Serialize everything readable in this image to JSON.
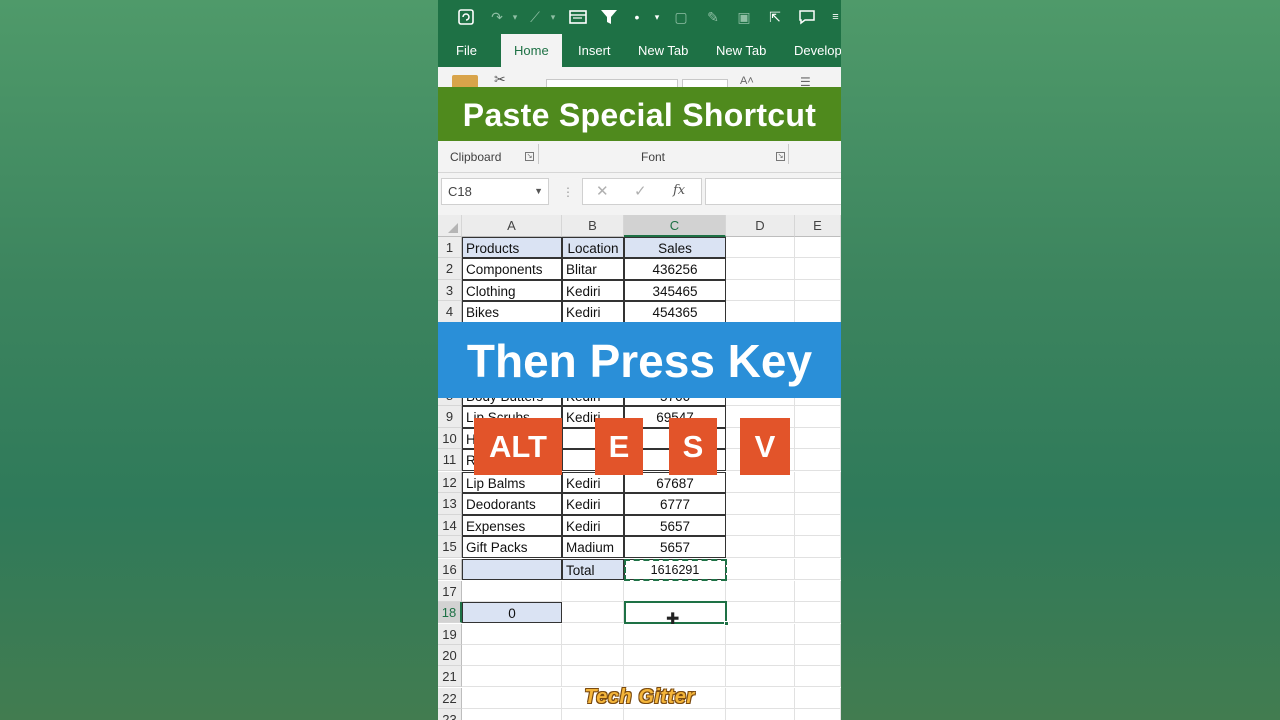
{
  "quick_access": {
    "icons": [
      "autosave-icon",
      "redo-icon",
      "chart-icon",
      "form-icon",
      "filter-icon",
      "dot-icon",
      "dropdown-icon",
      "sheet-icon",
      "brush-icon",
      "image-icon",
      "share-icon",
      "comment-icon",
      "more-icon"
    ]
  },
  "ribbon": {
    "tabs": [
      "File",
      "Home",
      "Insert",
      "New Tab",
      "New Tab",
      "Develop"
    ],
    "active_tab": "Home",
    "groups": [
      {
        "label": "Clipboard"
      },
      {
        "label": "Font"
      }
    ]
  },
  "overlay": {
    "title": "Paste Special Shortcut",
    "instruction": "Then Press Key",
    "keys": [
      "ALT",
      "E",
      "S",
      "V"
    ],
    "watermark": "Tech Gitter",
    "colors": {
      "title_bg": "#4f8a1d",
      "instruction_bg": "#2a8fd8",
      "key_bg": "#e2542a"
    }
  },
  "formula_bar": {
    "name_box": "C18",
    "cancel": "✕",
    "enter": "✓",
    "fx": "fx",
    "formula": ""
  },
  "grid": {
    "columns": [
      "A",
      "B",
      "C",
      "D",
      "E"
    ],
    "selected_column": "C",
    "rows": [
      "1",
      "2",
      "3",
      "4",
      "8",
      "9",
      "10",
      "11",
      "12",
      "13",
      "14",
      "15",
      "16",
      "17",
      "18",
      "19",
      "20",
      "21",
      "22",
      "23"
    ],
    "selected_row": "18",
    "header": {
      "a": "Products",
      "b": "Location",
      "c": "Sales"
    },
    "data": [
      {
        "row": "2",
        "a": "Components",
        "b": "Blitar",
        "c": "436256"
      },
      {
        "row": "3",
        "a": "Clothing",
        "b": "Kediri",
        "c": "345465"
      },
      {
        "row": "4",
        "a": "Bikes",
        "b": "Kediri",
        "c": "454365"
      },
      {
        "row": "8",
        "a": "Body Butters",
        "b": "Kediri",
        "c": "5766"
      },
      {
        "row": "9",
        "a": "Lip Scrubs",
        "b": "Kediri",
        "c": "69547"
      },
      {
        "row": "10",
        "a": "H",
        "b": "",
        "c": ""
      },
      {
        "row": "11",
        "a": "R",
        "b": "",
        "c": ""
      },
      {
        "row": "12",
        "a": "Lip Balms",
        "b": "Kediri",
        "c": "67687"
      },
      {
        "row": "13",
        "a": "Deodorants",
        "b": "Kediri",
        "c": "6777"
      },
      {
        "row": "14",
        "a": "Expenses",
        "b": "Kediri",
        "c": "5657"
      },
      {
        "row": "15",
        "a": "Gift Packs",
        "b": "Madium",
        "c": "5657"
      }
    ],
    "total_label": "Total",
    "total_value": "1616291",
    "a18_value": "0"
  }
}
